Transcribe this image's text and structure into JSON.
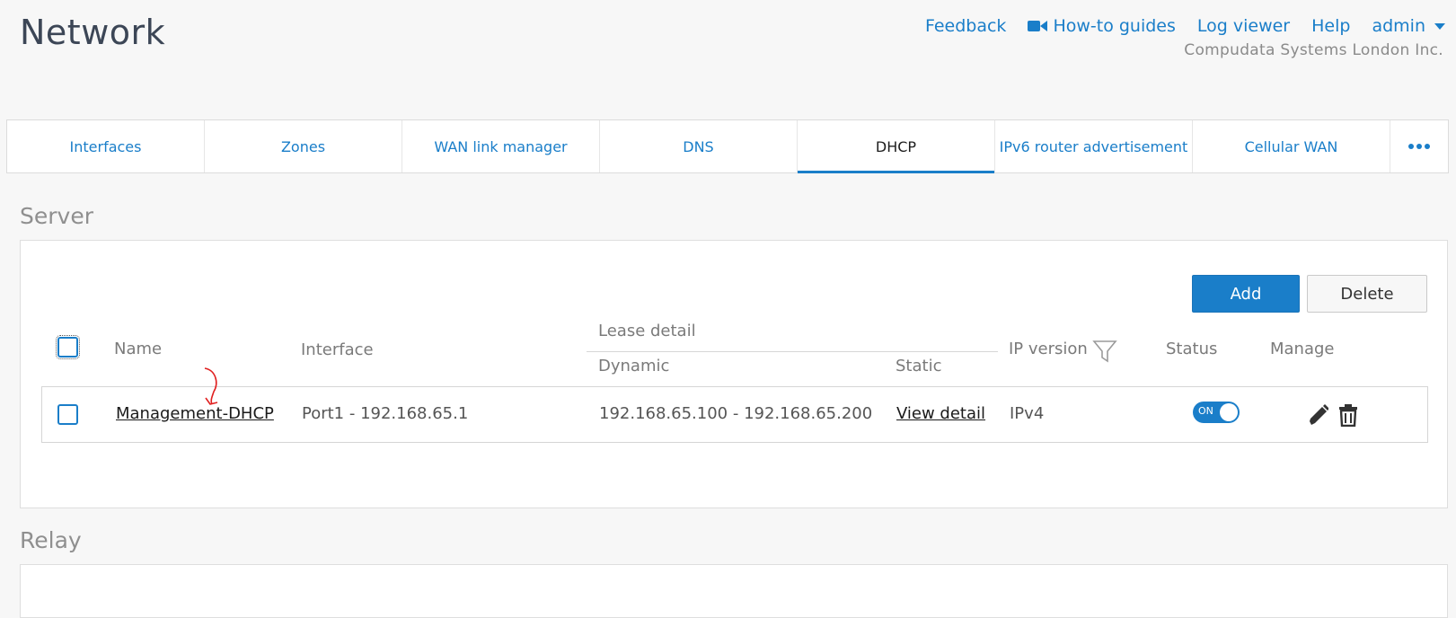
{
  "page": {
    "title": "Network"
  },
  "header": {
    "links": [
      {
        "label": "Feedback"
      },
      {
        "label": "How-to guides",
        "icon": "video-camera-icon"
      },
      {
        "label": "Log viewer"
      },
      {
        "label": "Help"
      },
      {
        "label": "admin",
        "icon": "caret-down-icon"
      }
    ],
    "company": "Compudata Systems London Inc."
  },
  "tabs": [
    {
      "label": "Interfaces"
    },
    {
      "label": "Zones"
    },
    {
      "label": "WAN link manager"
    },
    {
      "label": "DNS"
    },
    {
      "label": "DHCP",
      "active": true
    },
    {
      "label": "IPv6 router advertisement"
    },
    {
      "label": "Cellular WAN"
    },
    {
      "label": "",
      "icon": "more-dots-icon"
    }
  ],
  "server": {
    "title": "Server",
    "add_label": "Add",
    "delete_label": "Delete",
    "columns": {
      "name": "Name",
      "interface": "Interface",
      "lease_detail": "Lease detail",
      "dynamic": "Dynamic",
      "static": "Static",
      "ip_version": "IP version",
      "status": "Status",
      "manage": "Manage"
    },
    "rows": [
      {
        "name": "Management-DHCP",
        "interface": "Port1 - 192.168.65.1",
        "dynamic": "192.168.65.100 - 192.168.65.200",
        "static": "View detail",
        "ip_version": "IPv4",
        "status_label": "ON",
        "status_on": true
      }
    ]
  },
  "relay": {
    "title": "Relay"
  },
  "colors": {
    "accent": "#1a7ec9",
    "annotation": "#e02020"
  }
}
